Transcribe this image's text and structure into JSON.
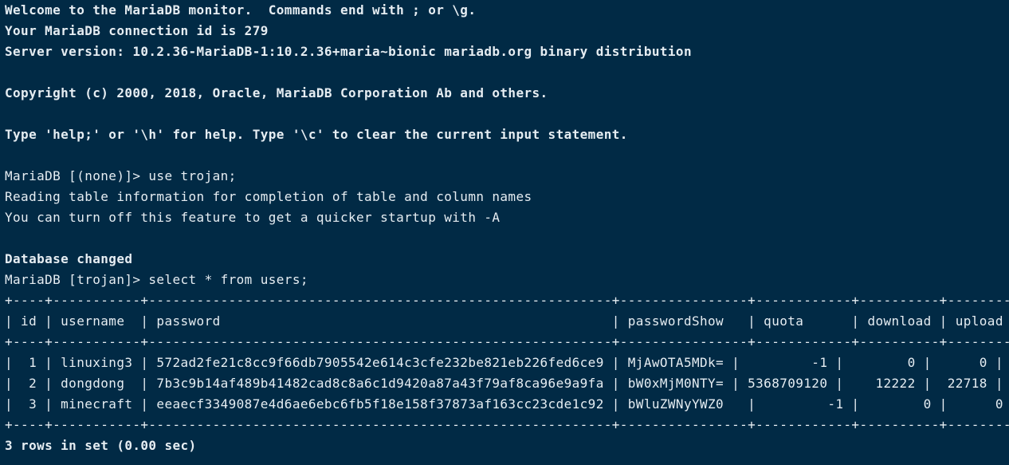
{
  "terminal": {
    "background": "#012a45",
    "foreground": "#e6edf2",
    "banner": {
      "welcome": "Welcome to the MariaDB monitor.  Commands end with ; or \\g.",
      "connection": "Your MariaDB connection id is 279",
      "server_version": "Server version: 10.2.36-MariaDB-1:10.2.36+maria~bionic mariadb.org binary distribution",
      "copyright": "Copyright (c) 2000, 2018, Oracle, MariaDB Corporation Ab and others.",
      "help": "Type 'help;' or '\\h' for help. Type '\\c' to clear the current input statement."
    },
    "session": {
      "prompt1": "MariaDB [(none)]> use trojan;",
      "reading": "Reading table information for completion of table and column names",
      "turn_off": "You can turn off this feature to get a quicker startup with -A",
      "db_changed": "Database changed",
      "prompt2": "MariaDB [trojan]> select * from users;"
    },
    "table": {
      "border": "+----+-----------+----------------------------------------------------------+----------------+------------+----------+--------+",
      "header": "| id | username  | password                                                 | passwordShow   | quota      | download | upload |",
      "rows": [
        "|  1 | linuxing3 | 572ad2fe21c8cc9f66db7905542e614c3cfe232be821eb226fed6ce9 | MjAwOTA5MDk= |         -1 |        0 |      0 |",
        "|  2 | dongdong  | 7b3c9b14af489b41482cad8c8a6c1d9420a87a43f79af8ca96e9a9fa | bW0xMjM0NTY= | 5368709120 |    12222 |  22718 |",
        "|  3 | minecraft | eeaecf3349087e4d6ae6ebc6fb5f18e158f37873af163cc23cde1c92 | bWluZWNyYWZ0   |         -1 |        0 |      0 |"
      ]
    },
    "result": "3 rows in set (0.00 sec)"
  }
}
